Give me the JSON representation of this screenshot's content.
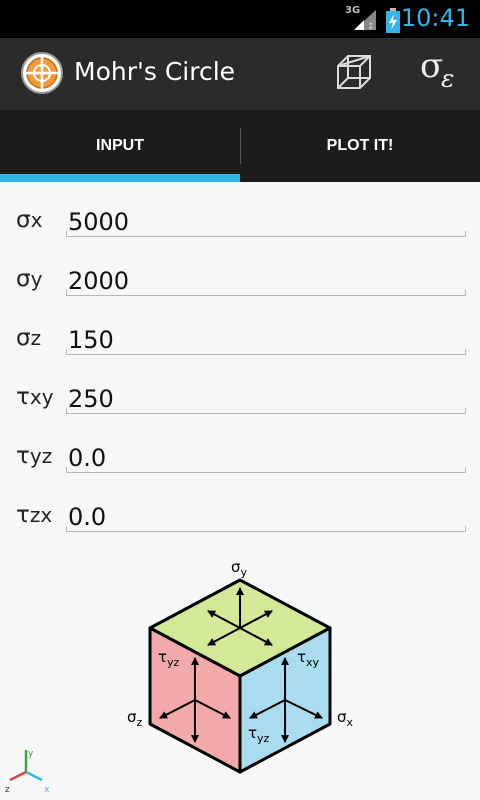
{
  "status_bar": {
    "network": "3G",
    "time": "10:41"
  },
  "app_bar": {
    "title": "Mohr's Circle",
    "strain_button": {
      "sigma": "σ",
      "epsilon": "ε"
    }
  },
  "tabs": [
    {
      "label": "INPUT",
      "selected": true
    },
    {
      "label": "PLOT IT!",
      "selected": false
    }
  ],
  "fields": [
    {
      "symbol": "σ",
      "sub": "x",
      "value": "5000"
    },
    {
      "symbol": "σ",
      "sub": "y",
      "value": "2000"
    },
    {
      "symbol": "σ",
      "sub": "z",
      "value": "150"
    },
    {
      "symbol": "τ",
      "sub": "xy",
      "value": "250"
    },
    {
      "symbol": "τ",
      "sub": "yz",
      "value": "0.0"
    },
    {
      "symbol": "τ",
      "sub": "zx",
      "value": "0.0"
    }
  ],
  "stress_element": {
    "labels": {
      "sy": {
        "sym": "σ",
        "sub": "y"
      },
      "sx": {
        "sym": "σ",
        "sub": "x"
      },
      "sz": {
        "sym": "σ",
        "sub": "z"
      },
      "tyz_left": {
        "sym": "τ",
        "sub": "yz"
      },
      "txy": {
        "sym": "τ",
        "sub": "xy"
      },
      "tyz_right": {
        "sym": "τ",
        "sub": "yz"
      }
    },
    "face_colors": {
      "top": "#d4e89a",
      "left": "#f2a9a9",
      "right": "#a9dcee"
    }
  },
  "axes_icon": {
    "y": "y",
    "z": "z",
    "x": "x"
  },
  "colors": {
    "accent": "#33b5e5",
    "action_bar": "#2b2b2b",
    "tab_bar": "#1c1c1c"
  }
}
